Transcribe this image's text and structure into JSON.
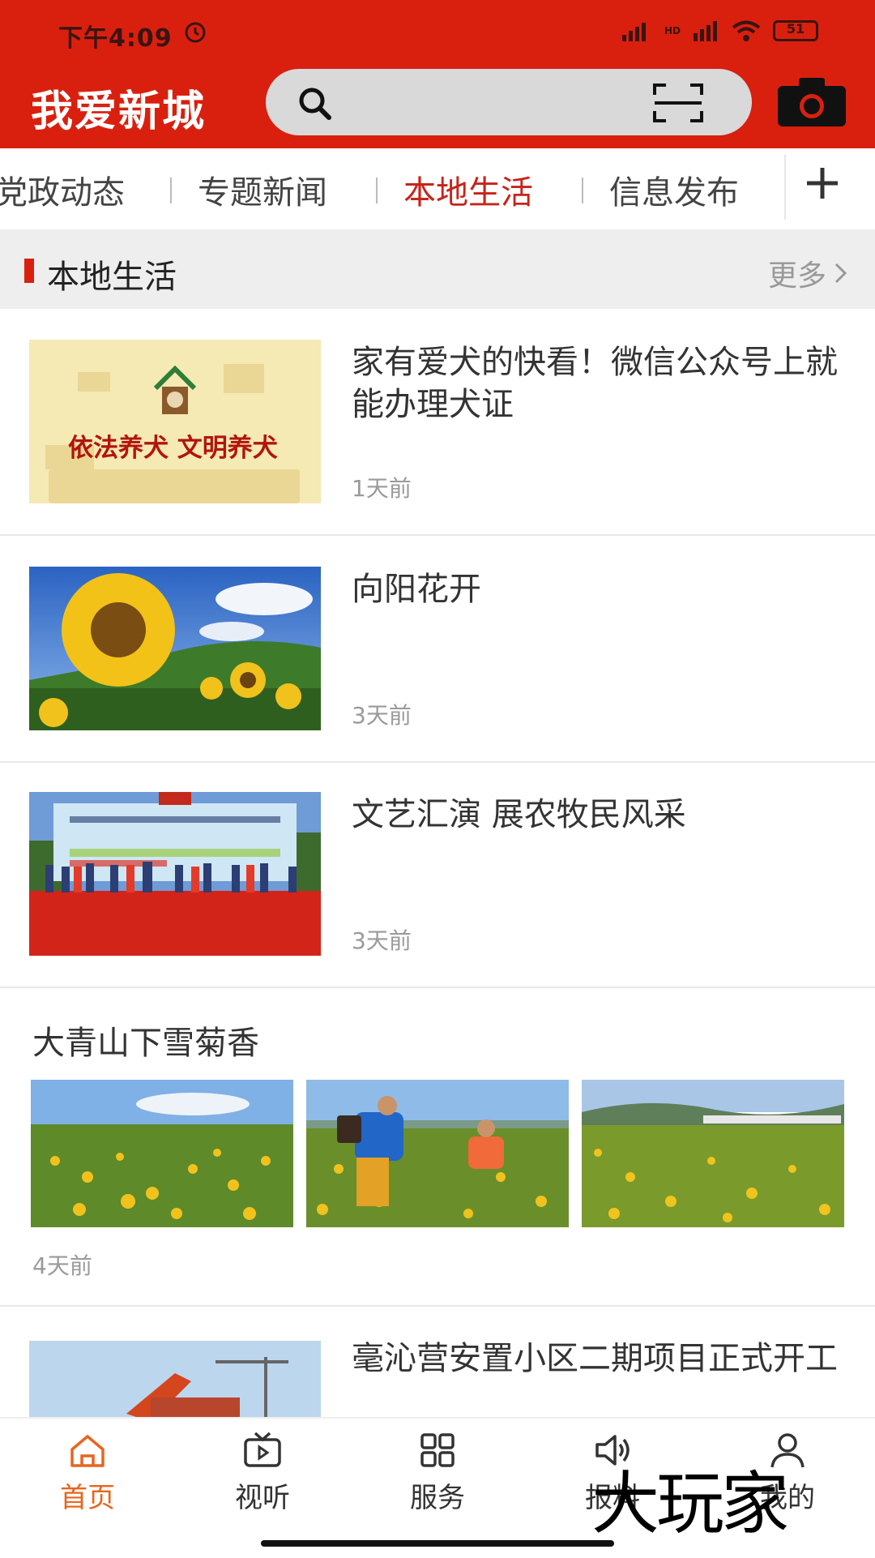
{
  "status_bar": {
    "time": "下午4:09",
    "network": "HD",
    "battery": "51"
  },
  "header": {
    "app_title": "我爱新城"
  },
  "tabs": [
    {
      "label": "党政动态",
      "active": false
    },
    {
      "label": "专题新闻",
      "active": false
    },
    {
      "label": "本地生活",
      "active": true
    },
    {
      "label": "信息发布",
      "active": false
    }
  ],
  "section": {
    "title": "本地生活",
    "more": "更多"
  },
  "news": [
    {
      "title": "家有爱犬的快看！微信公众号上就能办理犬证",
      "time": "1天前",
      "thumb_text": "依法养犬 文明养犬"
    },
    {
      "title": "向阳花开",
      "time": "3天前"
    },
    {
      "title": "文艺汇演  展农牧民风采",
      "time": "3天前"
    }
  ],
  "gallery": {
    "title": "大青山下雪菊香",
    "time": "4天前"
  },
  "partial_news": {
    "title": "毫沁营安置小区二期项目正式开工"
  },
  "bottom_nav": [
    {
      "label": "首页",
      "icon": "home-icon",
      "active": true
    },
    {
      "label": "视听",
      "icon": "tv-icon",
      "active": false
    },
    {
      "label": "服务",
      "icon": "grid-icon",
      "active": false
    },
    {
      "label": "报料",
      "icon": "speaker-icon",
      "active": false
    },
    {
      "label": "我的",
      "icon": "user-icon",
      "active": false
    }
  ],
  "watermark": "大玩家",
  "colors": {
    "brand_red": "#d9200f",
    "active_tab": "#c8241b",
    "nav_active": "#e8651e"
  }
}
